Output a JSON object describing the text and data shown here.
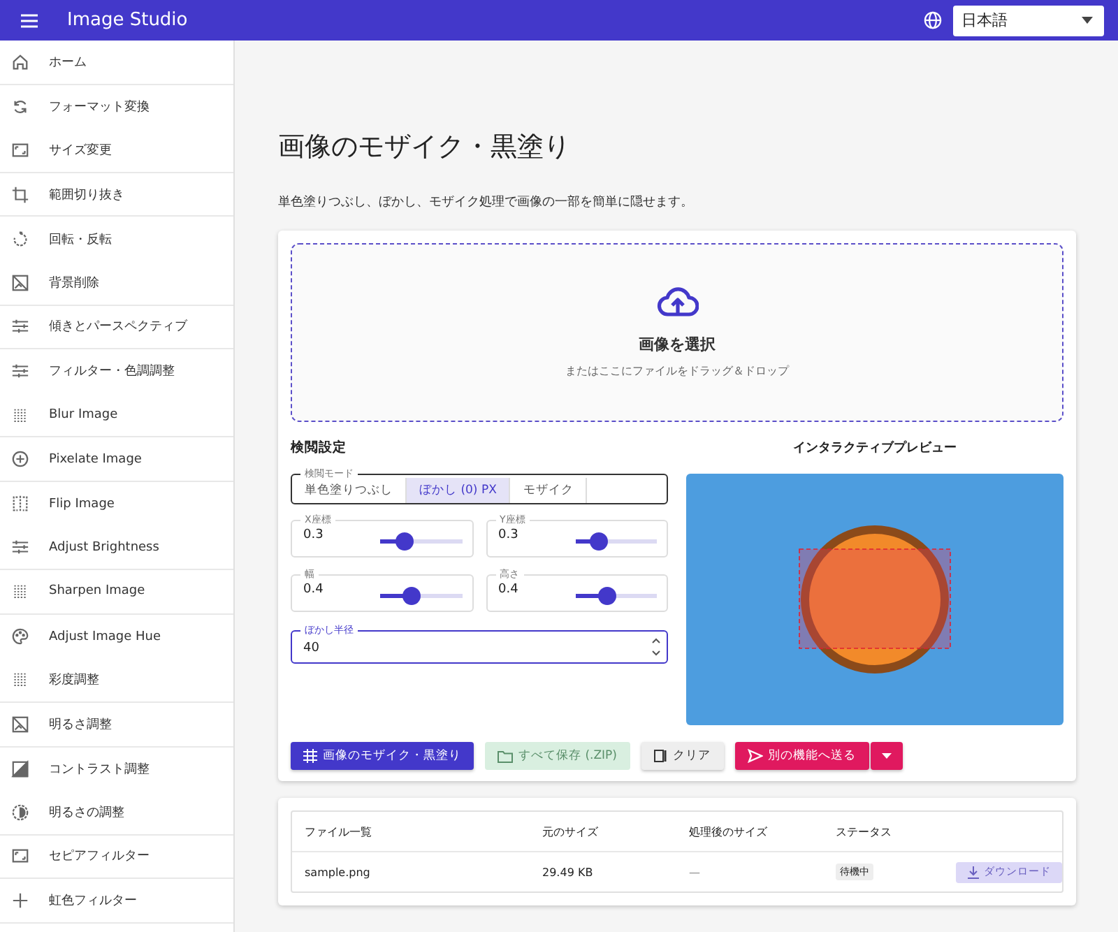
{
  "app_bar": {
    "title": "Image Studio",
    "language": "日本語"
  },
  "sidebar": {
    "items": [
      {
        "label": "ホーム",
        "selected": false
      },
      {
        "label": "フォーマット変換",
        "selected": false
      },
      {
        "label": "サイズ変更",
        "selected": false
      },
      {
        "label": "範囲切り抜き",
        "selected": false
      },
      {
        "label": "回転・反転",
        "selected": false
      },
      {
        "label": "背景削除",
        "selected": false
      },
      {
        "label": "傾きとパースペクティブ",
        "selected": false
      },
      {
        "label": "フィルター・色調調整",
        "selected": false
      },
      {
        "label": "Blur Image",
        "selected": false
      },
      {
        "label": "Pixelate Image",
        "selected": false
      },
      {
        "label": "Flip Image",
        "selected": false
      },
      {
        "label": "Adjust Brightness",
        "selected": false
      },
      {
        "label": "Sharpen Image",
        "selected": false
      },
      {
        "label": "Adjust Image Hue",
        "selected": false
      },
      {
        "label": "彩度調整",
        "selected": false
      },
      {
        "label": "明るさ調整",
        "selected": false
      },
      {
        "label": "コントラスト調整",
        "selected": false
      },
      {
        "label": "明るさの調整",
        "selected": false
      },
      {
        "label": "セピアフィルター",
        "selected": false
      },
      {
        "label": "虹色フィルター",
        "selected": false
      }
    ]
  },
  "page": {
    "title": "画像のモザイク・黒塗り",
    "description": "単色塗りつぶし、ぼかし、モザイク処理で画像の一部を簡単に隠せます。"
  },
  "dropzone": {
    "title": "画像を選択",
    "hint": "またはここにファイルをドラッグ＆ドロップ"
  },
  "settings": {
    "heading": "検閲設定",
    "mode_label": "検閲モード",
    "modes": [
      {
        "label": "単色塗りつぶし",
        "selected": false
      },
      {
        "label": "ぼかし (0) PX",
        "selected": true
      },
      {
        "label": "モザイク",
        "selected": false
      }
    ],
    "sliders": [
      {
        "label": "X座標",
        "value": "0.3",
        "level": 0.3
      },
      {
        "label": "Y座標",
        "value": "0.3",
        "level": 0.3
      },
      {
        "label": "幅",
        "value": "0.4",
        "level": 0.4
      },
      {
        "label": "高さ",
        "value": "0.4",
        "level": 0.4
      }
    ],
    "radius": {
      "label": "ぼかし半径",
      "value": "40"
    }
  },
  "preview": {
    "heading": "インタラクティブプレビュー",
    "kind": "picture"
  },
  "actions": [
    {
      "label": "画像のモザイク・黒塗り",
      "kind": "primary",
      "disabled": false
    },
    {
      "label": "すべて保存 (.ZIP)",
      "kind": "success",
      "disabled": true
    },
    {
      "label": "クリア",
      "kind": "plain",
      "disabled": false
    },
    {
      "label": "別の機能へ送る",
      "kind": "accent",
      "disabled": false
    }
  ],
  "file_table": {
    "columns": [
      "ファイル一覧",
      "元のサイズ",
      "処理後のサイズ",
      "ステータス"
    ],
    "rows": [
      {
        "name": "sample.png",
        "original_size": "29.49 KB",
        "processed_size": "—",
        "status": "待機中",
        "download": {
          "label": "ダウンロード",
          "disabled": true
        }
      }
    ]
  }
}
